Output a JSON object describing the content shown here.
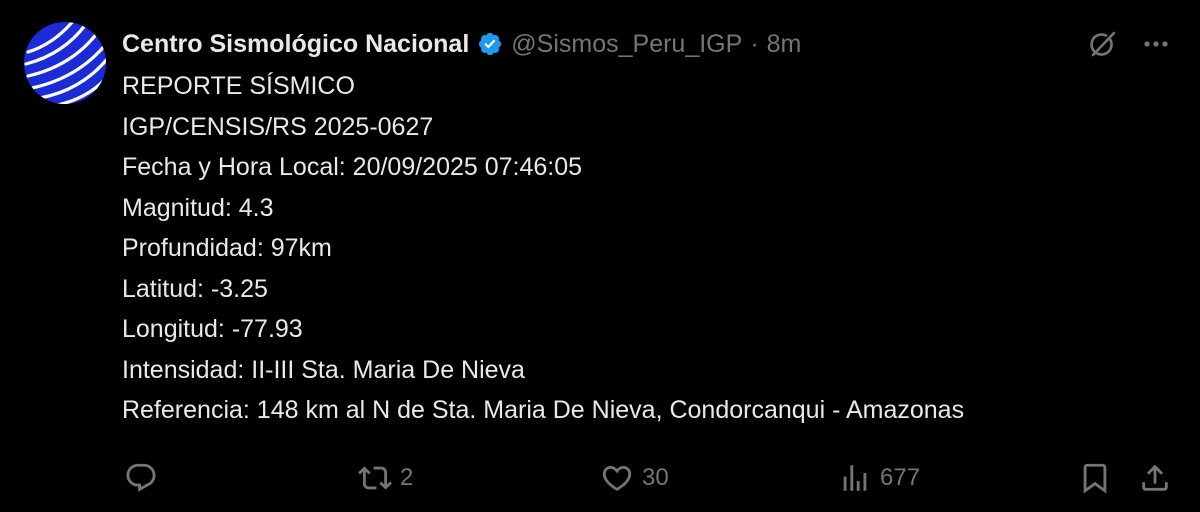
{
  "author": {
    "display_name": "Centro Sismológico Nacional",
    "handle": "@Sismos_Peru_IGP",
    "separator": "·",
    "time": "8m",
    "verified": true
  },
  "tweet": {
    "lines": [
      "REPORTE SÍSMICO",
      "IGP/CENSIS/RS 2025-0627",
      "Fecha y Hora Local: 20/09/2025 07:46:05",
      "Magnitud: 4.3",
      "Profundidad: 97km",
      "Latitud: -3.25",
      "Longitud: -77.93",
      "Intensidad: II-III Sta. Maria De Nieva",
      "Referencia: 148 km al N de Sta. Maria De Nieva, Condorcanqui - Amazonas"
    ]
  },
  "actions": {
    "reply_count": "",
    "repost_count": "2",
    "like_count": "30",
    "views_count": "677"
  },
  "icons": {
    "verified": "verified-badge-icon",
    "grok": "grok-icon",
    "more": "more-icon",
    "reply": "reply-icon",
    "repost": "repost-icon",
    "like": "heart-icon",
    "views": "views-icon",
    "bookmark": "bookmark-icon",
    "share": "share-icon"
  },
  "colors": {
    "background": "#000000",
    "text": "#e7e9ea",
    "muted": "#71767b",
    "verified": "#1d9bf0",
    "avatar": "#1b2bd8"
  }
}
